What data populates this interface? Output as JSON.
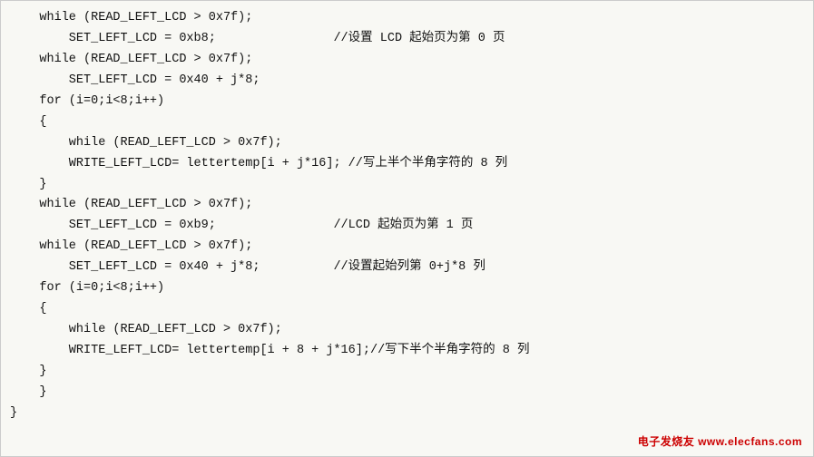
{
  "code": {
    "lines": [
      {
        "text": "    while (READ_LEFT_LCD > 0x7f);"
      },
      {
        "text": "        SET_LEFT_LCD = 0xb8;                //设置 LCD 起始页为第 0 页"
      },
      {
        "text": "    while (READ_LEFT_LCD > 0x7f);"
      },
      {
        "text": "        SET_LEFT_LCD = 0x40 + j*8;"
      },
      {
        "text": "    for (i=0;i<8;i++)"
      },
      {
        "text": "    {"
      },
      {
        "text": "        while (READ_LEFT_LCD > 0x7f);"
      },
      {
        "text": "        WRITE_LEFT_LCD= lettertemp[i + j*16]; //写上半个半角字符的 8 列"
      },
      {
        "text": "    }"
      },
      {
        "text": "    while (READ_LEFT_LCD > 0x7f);"
      },
      {
        "text": "        SET_LEFT_LCD = 0xb9;                //LCD 起始页为第 1 页"
      },
      {
        "text": "    while (READ_LEFT_LCD > 0x7f);"
      },
      {
        "text": "        SET_LEFT_LCD = 0x40 + j*8;          //设置起始列第 0+j*8 列"
      },
      {
        "text": "    for (i=0;i<8;i++)"
      },
      {
        "text": "    {"
      },
      {
        "text": "        while (READ_LEFT_LCD > 0x7f);"
      },
      {
        "text": "        WRITE_LEFT_LCD= lettertemp[i + 8 + j*16];//写下半个半角字符的 8 列"
      },
      {
        "text": "    }"
      },
      {
        "text": "    }"
      },
      {
        "text": "}"
      }
    ],
    "watermark": "电子发烧友 www.elecfans.com"
  }
}
